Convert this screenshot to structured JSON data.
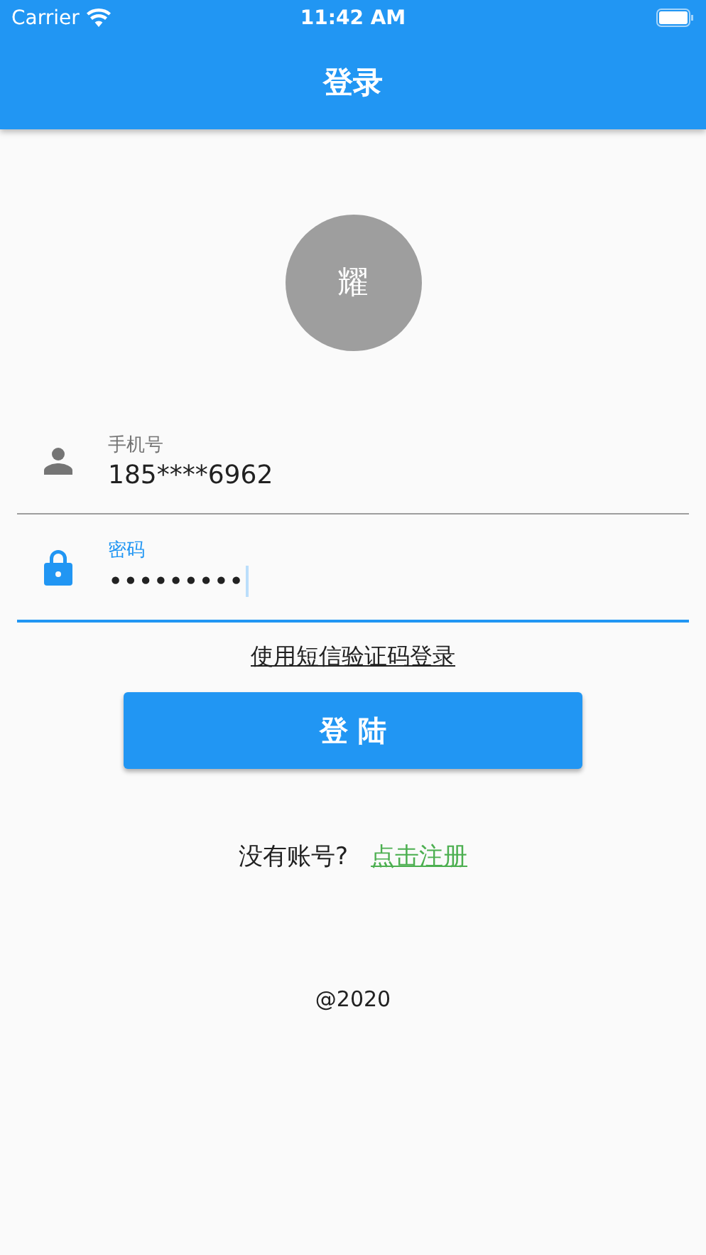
{
  "status_bar": {
    "carrier": "Carrier",
    "time": "11:42 AM"
  },
  "app_bar": {
    "title": "登录"
  },
  "avatar": {
    "initial": "耀"
  },
  "fields": [
    {
      "kind": "phone",
      "label": "手机号",
      "value": "185****6962",
      "focused": false
    },
    {
      "kind": "password",
      "label": "密码",
      "value": "•••••••••",
      "focused": true
    }
  ],
  "sms_login_link": "使用短信验证码登录",
  "login_button": "登 陆",
  "register": {
    "prompt": "没有账号?",
    "link": "点击注册"
  },
  "footer": "@2020"
}
